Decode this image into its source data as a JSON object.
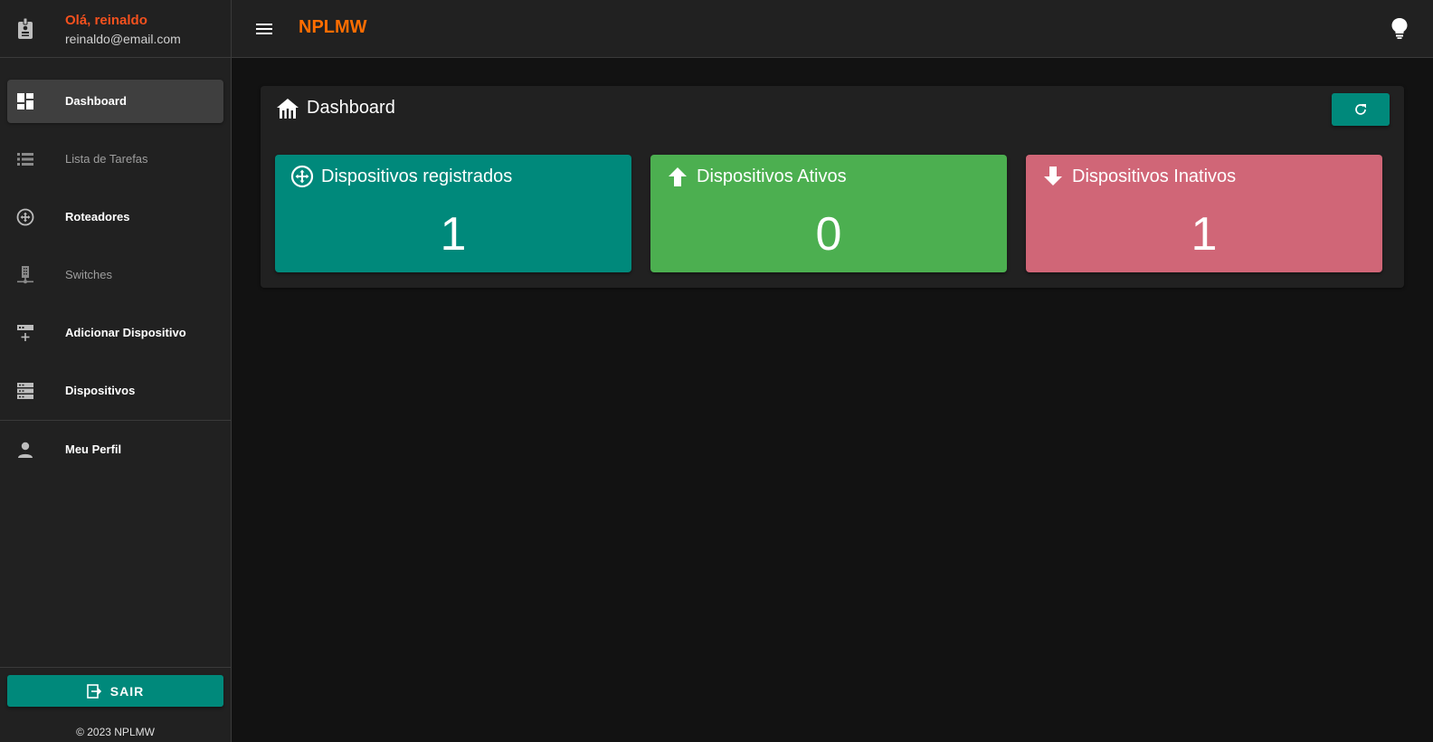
{
  "user": {
    "greeting": "Olá, reinaldo",
    "email": "reinaldo@email.com"
  },
  "sidebar": {
    "items": [
      {
        "label": "Dashboard",
        "icon": "dashboard-icon",
        "active": true
      },
      {
        "label": "Lista de Tarefas",
        "icon": "list-icon",
        "active": false
      },
      {
        "label": "Roteadores",
        "icon": "router-icon",
        "active": false
      },
      {
        "label": "Switches",
        "icon": "switch-icon",
        "active": false
      },
      {
        "label": "Adicionar Dispositivo",
        "icon": "add-device-icon",
        "active": false
      },
      {
        "label": "Dispositivos",
        "icon": "devices-icon",
        "active": false
      },
      {
        "label": "Meu Perfil",
        "icon": "person-icon",
        "active": false
      }
    ],
    "logout_label": "SAIR",
    "footer": "© 2023 NPLMW"
  },
  "header": {
    "title": "NPLMW"
  },
  "dashboard": {
    "title": "Dashboard",
    "cards": [
      {
        "title": "Dispositivos registrados",
        "value": "1",
        "color": "#00897b",
        "icon": "router-icon"
      },
      {
        "title": "Dispositivos Ativos",
        "value": "0",
        "color": "#4caf50",
        "icon": "arrow-up-icon"
      },
      {
        "title": "Dispositivos Inativos",
        "value": "1",
        "color": "#d06677",
        "icon": "arrow-down-icon"
      }
    ]
  },
  "colors": {
    "accent": "#00897b",
    "brand": "#ff6d00",
    "greeting": "#f4511e",
    "sidebar_bg": "#212121",
    "page_bg": "#121212"
  }
}
